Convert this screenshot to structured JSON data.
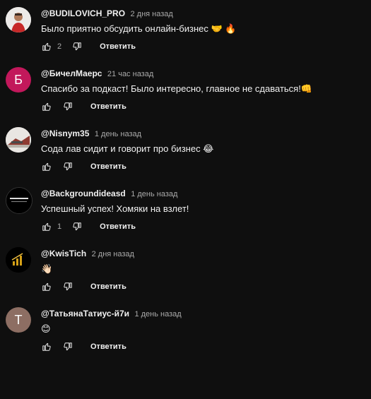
{
  "reply_label": "Ответить",
  "comments": [
    {
      "author": "@BUDILOVICH_PRO",
      "time": "2 дня назад",
      "text": "Было приятно обсудить онлайн-бизнес 🤝 🔥",
      "likes": "2",
      "avatar": {
        "type": "photo",
        "letter": "",
        "bg": "#e8e8e8"
      }
    },
    {
      "author": "@БичелМаерс",
      "time": "21 час назад",
      "text": "Спасибо за подкаст! Было интересно, главное не сдаваться!👊",
      "likes": "",
      "avatar": {
        "type": "letter",
        "letter": "Б",
        "bg": "#c2185b"
      }
    },
    {
      "author": "@Nisnym35",
      "time": "1 день назад",
      "text": "Сода лав сидит и говорит про бизнес 😂",
      "likes": "",
      "avatar": {
        "type": "photo",
        "letter": "",
        "bg": "#e9e6e2"
      }
    },
    {
      "author": "@Backgroundideasd",
      "time": "1 день назад",
      "text": "Успешный успех! Хомяки на взлет!",
      "likes": "1",
      "avatar": {
        "type": "logo",
        "letter": "",
        "bg": "#000000"
      }
    },
    {
      "author": "@KwisTich",
      "time": "2 дня назад",
      "text": "👋🏻",
      "likes": "",
      "avatar": {
        "type": "chart",
        "letter": "",
        "bg": "#000000"
      }
    },
    {
      "author": "@ТатьянаТатиус-й7и",
      "time": "1 день назад",
      "text": "😊",
      "likes": "",
      "avatar": {
        "type": "letter",
        "letter": "Т",
        "bg": "#8d6e63"
      }
    }
  ],
  "icons": {
    "like": "thumbs-up-icon",
    "dislike": "thumbs-down-icon"
  }
}
